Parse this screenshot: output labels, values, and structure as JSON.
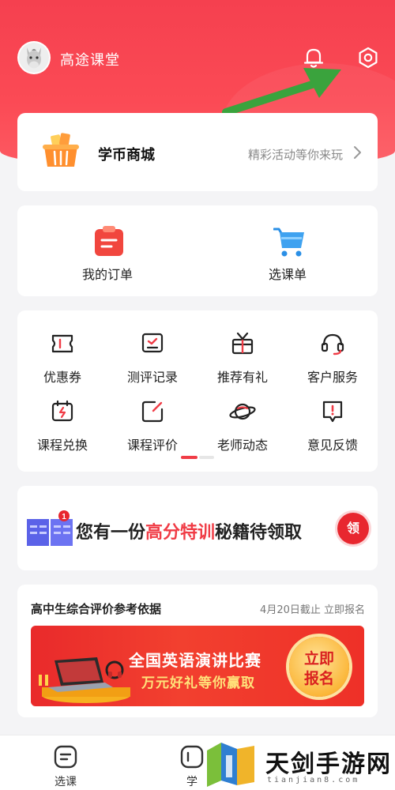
{
  "colors": {
    "brand_red": "#f5404f",
    "accent_red": "#f03c46",
    "claim_button": "#e8272f",
    "arrow_green": "#3aa33d",
    "promo_yellow": "#ffe27a"
  },
  "header": {
    "username": "高途课堂",
    "avatar_icon": "donkey-avatar-icon",
    "bell_icon": "bell-icon",
    "settings_icon": "gear-icon"
  },
  "mall": {
    "title": "学币商城",
    "subtitle": "精彩活动等你来玩",
    "icon": "basket-icon"
  },
  "orders": [
    {
      "label": "我的订单",
      "icon": "order-clipboard-icon"
    },
    {
      "label": "选课单",
      "icon": "shopping-cart-icon"
    }
  ],
  "services": [
    {
      "label": "优惠券",
      "icon": "coupon-icon"
    },
    {
      "label": "测评记录",
      "icon": "assessment-record-icon"
    },
    {
      "label": "推荐有礼",
      "icon": "gift-icon"
    },
    {
      "label": "客户服务",
      "icon": "headset-icon"
    },
    {
      "label": "课程兑换",
      "icon": "calendar-exchange-icon"
    },
    {
      "label": "课程评价",
      "icon": "edit-review-icon"
    },
    {
      "label": "老师动态",
      "icon": "planet-icon"
    },
    {
      "label": "意见反馈",
      "icon": "feedback-icon"
    }
  ],
  "promo": {
    "badge": "1",
    "text_before": "您有一份",
    "text_highlight": "高分特训",
    "text_after": "秘籍待领取",
    "claim_label": "领",
    "icon": "book-icon"
  },
  "ad": {
    "title": "高中生综合评价参考依据",
    "deadline": "4月20日截止 立即报名",
    "banner_main": "全国英语演讲比赛",
    "banner_sub": "万元好礼等你赢取",
    "banner_btn_line1": "立即",
    "banner_btn_line2": "报名"
  },
  "tabbar": {
    "items": [
      {
        "label": "选课",
        "icon": "course-list-icon"
      },
      {
        "label": "学",
        "icon": "study-icon"
      }
    ]
  },
  "watermark": {
    "text": "天剑手游网",
    "sub": "tianjian8.com"
  }
}
